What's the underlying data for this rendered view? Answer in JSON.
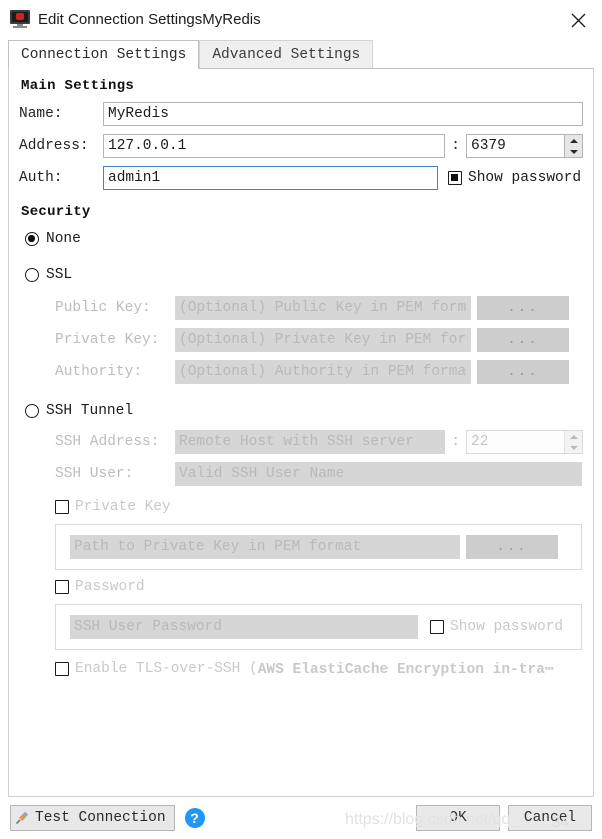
{
  "window": {
    "title": "Edit Connection SettingsMyRedis",
    "app_icon": "redis-monitor-icon",
    "close_label": "✕"
  },
  "tabs": [
    {
      "label": "Connection Settings",
      "active": true
    },
    {
      "label": "Advanced Settings",
      "active": false
    }
  ],
  "main_settings": {
    "heading": "Main Settings",
    "name": {
      "label": "Name:",
      "value": "MyRedis"
    },
    "address": {
      "label": "Address:",
      "value": "127.0.0.1"
    },
    "port": {
      "separator": ":",
      "value": "6379"
    },
    "auth": {
      "label": "Auth:",
      "value": "admin1"
    },
    "show_password": {
      "label": "Show password",
      "checked": true
    }
  },
  "security": {
    "heading": "Security",
    "options": [
      {
        "label": "None",
        "selected": true
      },
      {
        "label": "SSL",
        "selected": false
      },
      {
        "label": "SSH Tunnel",
        "selected": false
      }
    ],
    "ssl": {
      "public_key": {
        "label": "Public Key:",
        "placeholder": "(Optional) Public Key in PEM format",
        "browse": "..."
      },
      "private_key": {
        "label": "Private Key:",
        "placeholder": "(Optional) Private Key in PEM for⋯",
        "browse": "..."
      },
      "authority": {
        "label": "Authority:",
        "placeholder": "(Optional) Authority in PEM format",
        "browse": "..."
      }
    },
    "ssh": {
      "address": {
        "label": "SSH Address:",
        "placeholder": "Remote Host with SSH server"
      },
      "port": {
        "separator": ":",
        "value": "22"
      },
      "user": {
        "label": "SSH User:",
        "placeholder": "Valid SSH User Name"
      },
      "private_key_toggle": {
        "label": "Private Key",
        "checked": false
      },
      "private_key_path": {
        "placeholder": "Path to Private Key in PEM format",
        "browse": "..."
      },
      "password_toggle": {
        "label": "Password",
        "checked": false
      },
      "password_field": {
        "placeholder": "SSH User Password"
      },
      "password_show": {
        "label": "Show password",
        "checked": false
      },
      "tls_over_ssh": {
        "label_plain": "Enable TLS-over-SSH (",
        "label_bold": "AWS ElastiCache Encryption in-tra⋯",
        "checked": false
      }
    }
  },
  "footer": {
    "test_connection": "Test Connection",
    "help": "?",
    "ok": "OK",
    "cancel": "Cancel"
  },
  "watermark": {
    "text": "https://blog.csdn.net/qq_",
    "suffix": "34"
  }
}
